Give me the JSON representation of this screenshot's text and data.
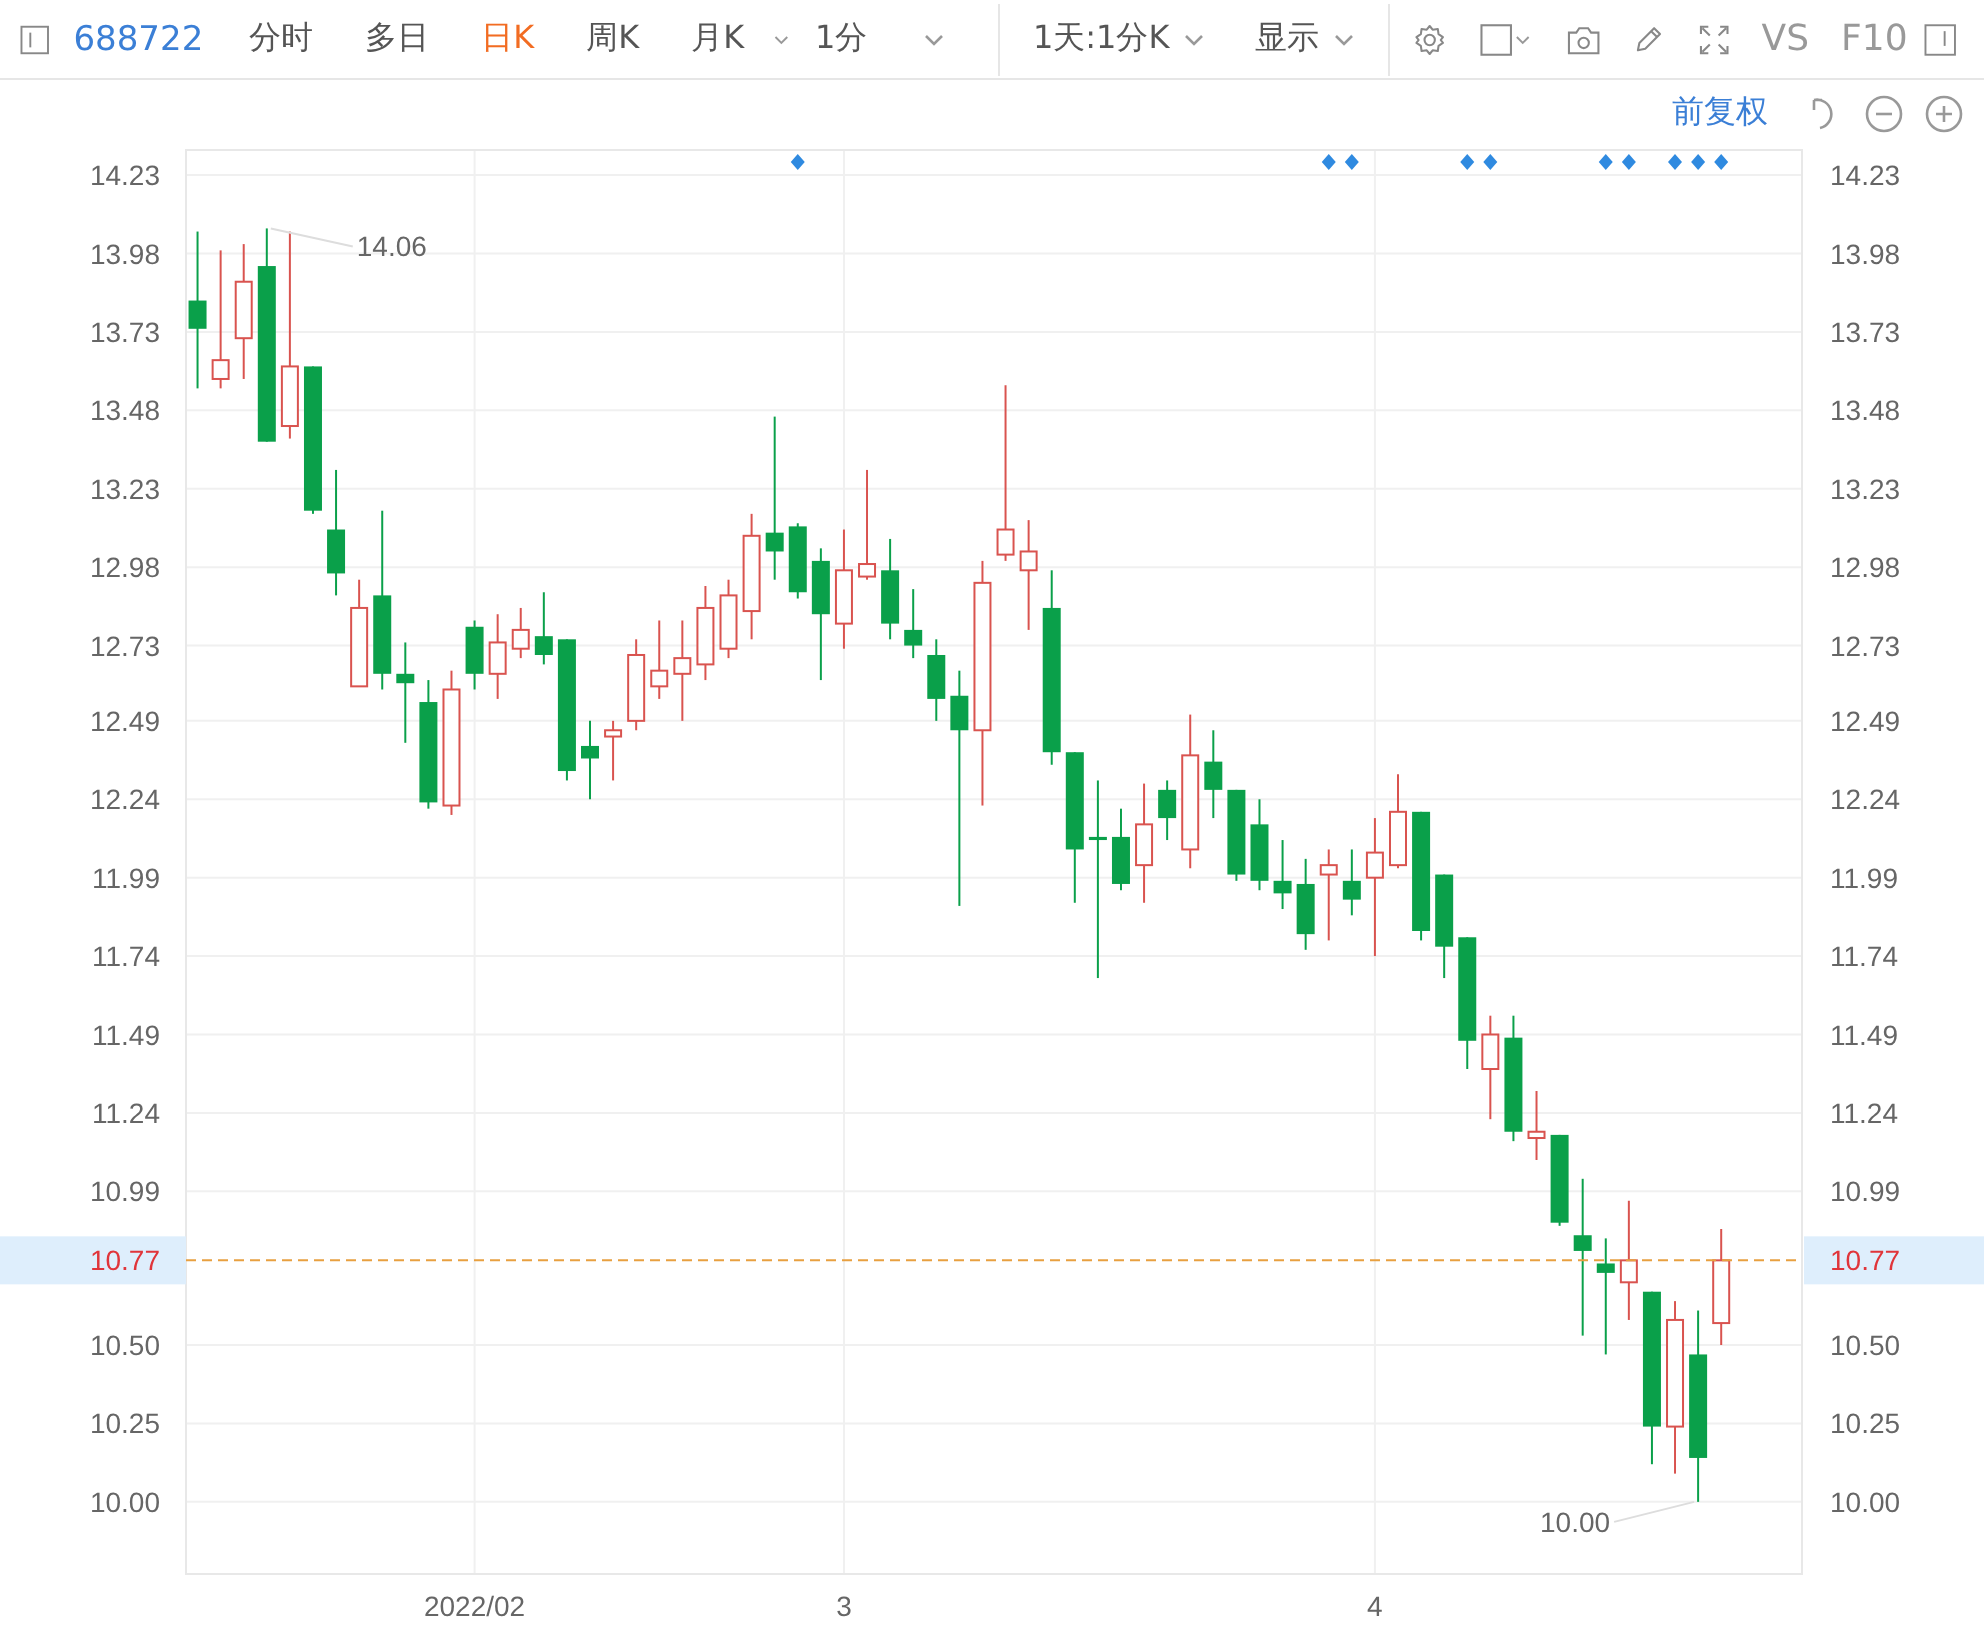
{
  "toolbar": {
    "code": "688722",
    "tabs": [
      {
        "label": "分时",
        "selected": false,
        "has_menu": false
      },
      {
        "label": "多日",
        "selected": false,
        "has_menu": false
      },
      {
        "label": "日K",
        "selected": true,
        "has_menu": false
      },
      {
        "label": "周K",
        "selected": false,
        "has_menu": false
      },
      {
        "label": "月K",
        "selected": false,
        "has_menu": true
      }
    ],
    "dropdowns": [
      "1分",
      "1天:1分K",
      "显示"
    ],
    "buttons": [
      "VS",
      "F10"
    ]
  },
  "adjustment": "前复权",
  "chart": {
    "chart_data": {
      "type": "candlestick",
      "categories": [
        null,
        null,
        null,
        null,
        null,
        null,
        null,
        null,
        null,
        null,
        null,
        null,
        "2022/02",
        null,
        null,
        null,
        null,
        null,
        null,
        null,
        null,
        null,
        null,
        null,
        null,
        null,
        null,
        null,
        "3",
        null,
        null,
        null,
        null,
        null,
        null,
        null,
        null,
        null,
        null,
        null,
        null,
        null,
        null,
        null,
        null,
        null,
        null,
        null,
        null,
        null,
        null,
        "4",
        null,
        null,
        null,
        null,
        null,
        null,
        null,
        null,
        null,
        null,
        null,
        null,
        null,
        null,
        null,
        null,
        null,
        null
      ],
      "ohlc": [
        [
          13.83,
          14.05,
          13.55,
          13.74
        ],
        [
          13.58,
          13.99,
          13.55,
          13.64
        ],
        [
          13.71,
          14.01,
          13.58,
          13.89
        ],
        [
          13.94,
          14.06,
          13.38,
          13.38
        ],
        [
          13.43,
          14.05,
          13.39,
          13.62
        ],
        [
          13.62,
          13.62,
          13.15,
          13.16
        ],
        [
          13.1,
          13.29,
          12.89,
          12.96
        ],
        [
          12.6,
          12.94,
          12.6,
          12.85
        ],
        [
          12.89,
          13.16,
          12.59,
          12.64
        ],
        [
          12.64,
          12.74,
          12.42,
          12.61
        ],
        [
          12.55,
          12.62,
          12.21,
          12.23
        ],
        [
          12.22,
          12.65,
          12.19,
          12.59
        ],
        [
          12.79,
          12.81,
          12.59,
          12.64
        ],
        [
          12.64,
          12.83,
          12.56,
          12.74
        ],
        [
          12.72,
          12.85,
          12.69,
          12.78
        ],
        [
          12.76,
          12.9,
          12.67,
          12.7
        ],
        [
          12.75,
          12.75,
          12.3,
          12.33
        ],
        [
          12.41,
          12.49,
          12.24,
          12.37
        ],
        [
          12.44,
          12.49,
          12.3,
          12.46
        ],
        [
          12.49,
          12.75,
          12.46,
          12.7
        ],
        [
          12.6,
          12.81,
          12.56,
          12.65
        ],
        [
          12.64,
          12.81,
          12.49,
          12.69
        ],
        [
          12.67,
          12.92,
          12.62,
          12.85
        ],
        [
          12.72,
          12.94,
          12.69,
          12.89
        ],
        [
          12.84,
          13.15,
          12.75,
          13.08
        ],
        [
          13.09,
          13.46,
          12.94,
          13.03
        ],
        [
          13.11,
          13.12,
          12.88,
          12.9
        ],
        [
          13.0,
          13.04,
          12.62,
          12.83
        ],
        [
          12.8,
          13.1,
          12.72,
          12.97
        ],
        [
          12.95,
          13.29,
          12.94,
          12.99
        ],
        [
          12.97,
          13.07,
          12.75,
          12.8
        ],
        [
          12.78,
          12.91,
          12.69,
          12.73
        ],
        [
          12.7,
          12.75,
          12.49,
          12.56
        ],
        [
          12.57,
          12.65,
          11.9,
          12.46
        ],
        [
          12.46,
          13.0,
          12.22,
          12.93
        ],
        [
          13.02,
          13.56,
          13.0,
          13.1
        ],
        [
          12.97,
          13.13,
          12.78,
          13.03
        ],
        [
          12.85,
          12.97,
          12.35,
          12.39
        ],
        [
          12.39,
          12.39,
          11.91,
          12.08
        ],
        [
          12.12,
          12.3,
          11.67,
          12.11
        ],
        [
          12.12,
          12.21,
          11.95,
          11.97
        ],
        [
          12.03,
          12.29,
          11.91,
          12.16
        ],
        [
          12.27,
          12.3,
          12.11,
          12.18
        ],
        [
          12.08,
          12.51,
          12.02,
          12.38
        ],
        [
          12.36,
          12.46,
          12.18,
          12.27
        ],
        [
          12.27,
          12.27,
          11.98,
          12.0
        ],
        [
          12.16,
          12.24,
          11.95,
          11.98
        ],
        [
          11.98,
          12.11,
          11.89,
          11.94
        ],
        [
          11.97,
          12.05,
          11.76,
          11.81
        ],
        [
          12.0,
          12.08,
          11.79,
          12.03
        ],
        [
          11.98,
          12.08,
          11.87,
          11.92
        ],
        [
          11.99,
          12.18,
          11.74,
          12.07
        ],
        [
          12.03,
          12.32,
          12.02,
          12.2
        ],
        [
          12.2,
          12.2,
          11.79,
          11.82
        ],
        [
          12.0,
          12.0,
          11.67,
          11.77
        ],
        [
          11.8,
          11.8,
          11.38,
          11.47
        ],
        [
          11.38,
          11.55,
          11.22,
          11.49
        ],
        [
          11.48,
          11.55,
          11.15,
          11.18
        ],
        [
          11.16,
          11.31,
          11.09,
          11.18
        ],
        [
          11.17,
          11.17,
          10.88,
          10.89
        ],
        [
          10.85,
          11.03,
          10.53,
          10.8
        ],
        [
          10.76,
          10.84,
          10.47,
          10.73
        ],
        [
          10.7,
          10.96,
          10.58,
          10.77
        ],
        [
          10.67,
          10.67,
          10.12,
          10.24
        ],
        [
          10.24,
          10.64,
          10.09,
          10.58
        ],
        [
          10.47,
          10.61,
          10.0,
          10.14
        ],
        [
          10.57,
          10.87,
          10.5,
          10.77
        ],
        null,
        null,
        null
      ],
      "ylim": [
        9.77,
        14.31
      ],
      "grid": true,
      "yticks": [
        {
          "value": 14.23,
          "label": "14.23"
        },
        {
          "value": 13.98,
          "label": "13.98"
        },
        {
          "value": 13.73,
          "label": "13.73"
        },
        {
          "value": 13.48,
          "label": "13.48"
        },
        {
          "value": 13.23,
          "label": "13.23"
        },
        {
          "value": 12.98,
          "label": "12.98"
        },
        {
          "value": 12.73,
          "label": "12.73"
        },
        {
          "value": 12.49,
          "label": "12.49"
        },
        {
          "value": 12.24,
          "label": "12.24"
        },
        {
          "value": 11.99,
          "label": "11.99"
        },
        {
          "value": 11.74,
          "label": "11.74"
        },
        {
          "value": 11.49,
          "label": "11.49"
        },
        {
          "value": 11.24,
          "label": "11.24"
        },
        {
          "value": 10.99,
          "label": "10.99"
        },
        {
          "value": 10.5,
          "label": "10.50"
        },
        {
          "value": 10.25,
          "label": "10.25"
        },
        {
          "value": 10.0,
          "label": "10.00"
        }
      ],
      "annotations": [
        "14.06",
        "10.00"
      ],
      "ref_lines": [
        {
          "axis": "y",
          "value": 10.77,
          "label": "10.77"
        }
      ]
    },
    "right_axis_labels": [
      "14.23",
      "13.98",
      "13.73",
      "13.48",
      "13.23",
      "12.98",
      "12.73",
      "12.49",
      "12.24",
      "11.99",
      "11.74",
      "11.49",
      "11.24",
      "10.99",
      "10.50",
      "10.25",
      "10.00"
    ],
    "right_price_tag": "10.77",
    "event_flags": [
      false,
      false,
      false,
      false,
      false,
      false,
      false,
      false,
      false,
      false,
      false,
      false,
      false,
      false,
      false,
      false,
      false,
      false,
      false,
      false,
      false,
      false,
      false,
      false,
      false,
      false,
      true,
      false,
      false,
      false,
      false,
      false,
      false,
      false,
      false,
      false,
      false,
      false,
      false,
      false,
      false,
      false,
      false,
      false,
      false,
      false,
      false,
      false,
      false,
      true,
      true,
      false,
      false,
      false,
      false,
      true,
      true,
      false,
      false,
      false,
      false,
      true,
      true,
      false,
      true,
      true,
      true
    ]
  }
}
